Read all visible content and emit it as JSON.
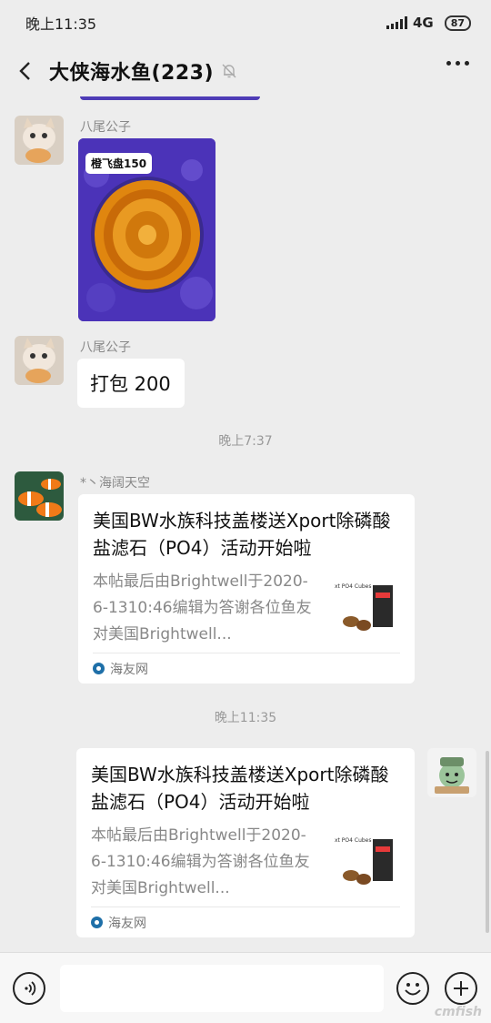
{
  "status_bar": {
    "time": "晚上11:35",
    "network": "4G",
    "battery": "87"
  },
  "header": {
    "title": "大侠海水鱼(223)"
  },
  "messages": [
    {
      "sender": "八尾公子",
      "image_label": "橙飞盘150"
    },
    {
      "sender": "八尾公子",
      "text": "打包 200"
    },
    {
      "time": "晚上7:37"
    },
    {
      "sender": "*丶海阔天空",
      "card_title": "美国BW水族科技盖楼送Xport除磷酸盐滤石（PO4）活动开始啦",
      "card_desc": "本帖最后由Brightwell于2020-6-1310:46编辑为答谢各位鱼友对美国Brightwell...",
      "card_source": "海友网",
      "thumb_text": "xt PO4 Cubes"
    },
    {
      "time": "晚上11:35"
    },
    {
      "card_title": "美国BW水族科技盖楼送Xport除磷酸盐滤石（PO4）活动开始啦",
      "card_desc": "本帖最后由Brightwell于2020-6-1310:46编辑为答谢各位鱼友对美国Brightwell...",
      "card_source": "海友网",
      "thumb_text": "xt PO4 Cubes"
    }
  ],
  "watermark": "cmfish",
  "colors": {
    "background": "#ededed",
    "bubble": "#ffffff",
    "image_bg": "#4b33b8",
    "coral": "#e0860f"
  }
}
